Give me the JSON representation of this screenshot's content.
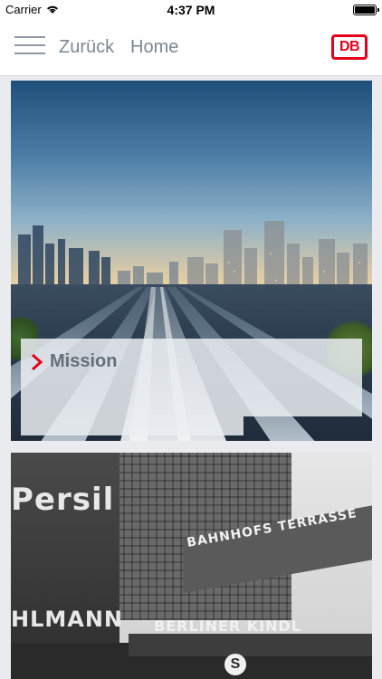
{
  "status_bar": {
    "carrier": "Carrier",
    "time": "4:37 PM"
  },
  "nav": {
    "back_label": "Zurück",
    "title": "Home",
    "logo_text": "DB"
  },
  "cards": [
    {
      "label": "Mission"
    },
    {
      "signs": {
        "persil": "Persil",
        "bahnhof": "BAHNHOFS TERRASSE",
        "berliner": "BERLINER KINDL",
        "hlmann": "HLMANN",
        "s": "S"
      }
    }
  ],
  "colors": {
    "db_red": "#e2001a",
    "nav_text": "#7b8793",
    "background": "#e9ebee"
  },
  "icons": [
    "wifi-icon",
    "battery-icon",
    "menu-icon",
    "db-logo",
    "chevron-right-icon"
  ]
}
